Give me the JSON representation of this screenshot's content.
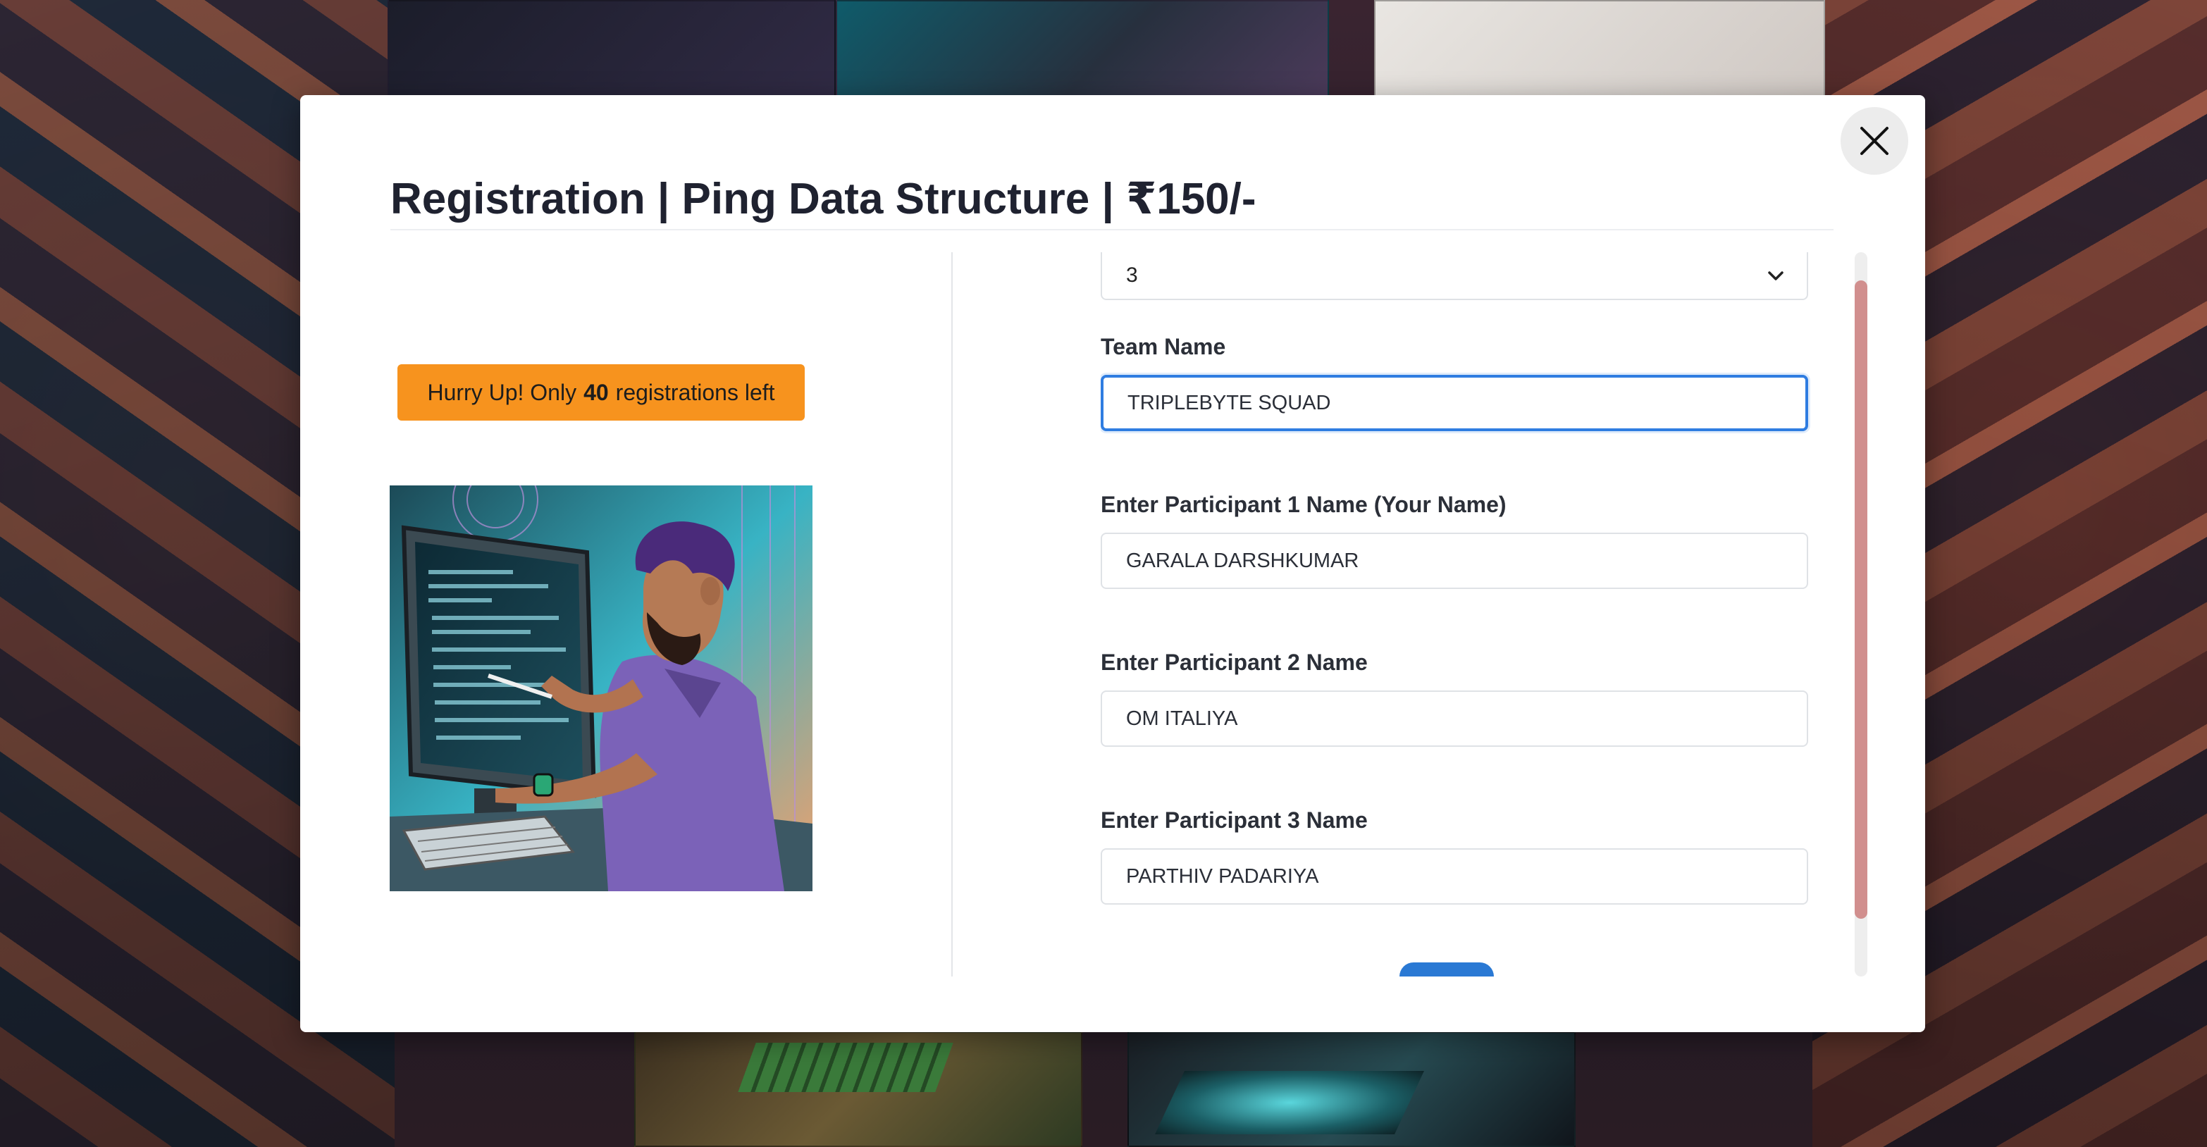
{
  "modal": {
    "title": "Registration | Ping Data Structure | ₹150/-",
    "close_icon": "close-icon"
  },
  "badge": {
    "prefix": "Hurry Up! Only",
    "count": "40",
    "suffix": "registrations left",
    "color": "#f7931e"
  },
  "illustration": {
    "subject": "developer-at-computer-illustration"
  },
  "form": {
    "team_size": {
      "value": "3",
      "icon": "chevron-down-icon"
    },
    "team_name": {
      "label": "Team Name",
      "value": "TRIPLEBYTE SQUAD"
    },
    "participant1": {
      "label": "Enter Participant 1 Name (Your Name)",
      "value": "GARALA DARSHKUMAR"
    },
    "participant2": {
      "label": "Enter Participant 2 Name",
      "value": "OM ITALIYA"
    },
    "participant3": {
      "label": "Enter Participant 3 Name",
      "value": "PARTHIV PADARIYA"
    },
    "focus_color": "#2f7de1"
  },
  "scrollbar": {
    "thumb_color": "#d18f8e"
  }
}
